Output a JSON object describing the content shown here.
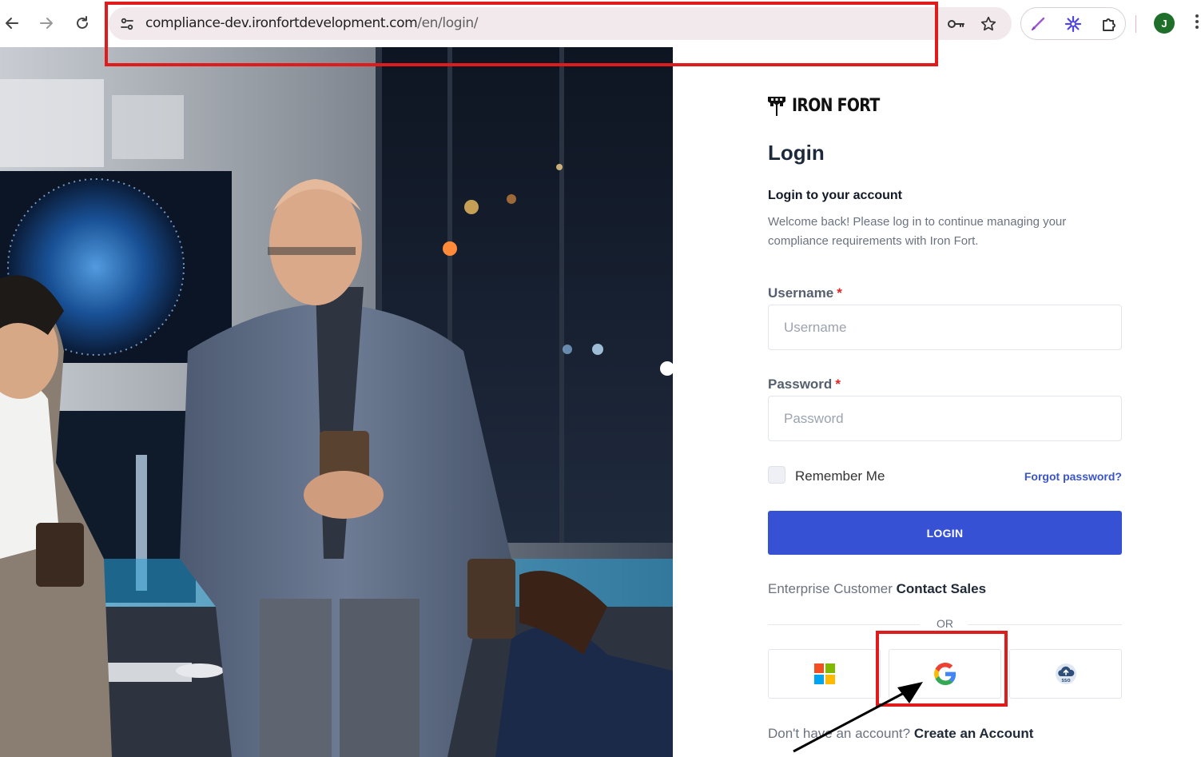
{
  "browser": {
    "url_host": "compliance-dev.ironfortdevelopment.com",
    "url_path": "/en/login/",
    "back_icon": "arrow-left-icon",
    "forward_icon": "arrow-right-icon",
    "reload_icon": "reload-icon",
    "site_info_icon": "tune-icon",
    "password_icon": "key-icon",
    "bookmark_icon": "star-icon",
    "extensions": [
      "pen-icon",
      "snowflake-icon",
      "puzzle-icon"
    ],
    "profile_initial": "J",
    "profile_color": "#1f6f2a"
  },
  "logo": {
    "text": "IRON FORT"
  },
  "login": {
    "title": "Login",
    "subtitle": "Login to your account",
    "description": "Welcome back! Please log in to continue managing your compliance requirements with Iron Fort.",
    "username_label": "Username",
    "username_placeholder": "Username",
    "username_value": "",
    "password_label": "Password",
    "password_placeholder": "Password",
    "password_value": "",
    "required_mark": "*",
    "remember_label": "Remember Me",
    "remember_checked": false,
    "forgot_link": "Forgot password?",
    "login_button": "LOGIN",
    "enterprise_text": "Enterprise Customer",
    "enterprise_link": "Contact Sales",
    "or_text": "OR",
    "social": [
      {
        "name": "microsoft",
        "icon": "microsoft-icon"
      },
      {
        "name": "google",
        "icon": "google-icon"
      },
      {
        "name": "sso",
        "icon": "sso-cloud-icon",
        "text": "SSO"
      }
    ],
    "signup_text": "Don't have an account?",
    "signup_link": "Create an Account"
  },
  "colors": {
    "primary": "#3651d4",
    "link": "#3a55c9",
    "required": "#dc2626",
    "annotation": "#e01b1b"
  }
}
